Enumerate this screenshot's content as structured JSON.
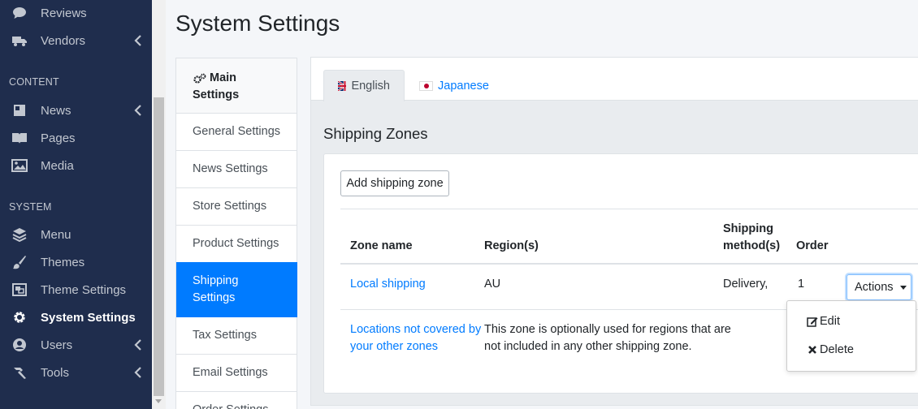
{
  "sidebar": {
    "items_top": [
      {
        "label": "Reviews",
        "icon": "comment-icon"
      },
      {
        "label": "Vendors",
        "icon": "truck-icon"
      }
    ],
    "header_content": "CONTENT",
    "content_items": [
      {
        "label": "News",
        "icon": "newspaper-icon"
      },
      {
        "label": "Pages",
        "icon": "book-icon"
      },
      {
        "label": "Media",
        "icon": "image-icon"
      }
    ],
    "header_system": "SYSTEM",
    "system_items": [
      {
        "label": "Menu",
        "icon": "layers-icon"
      },
      {
        "label": "Themes",
        "icon": "brush-icon"
      },
      {
        "label": "Theme Settings",
        "icon": "object-group-icon"
      },
      {
        "label": "System Settings",
        "icon": "gear-icon"
      },
      {
        "label": "Users",
        "icon": "users-icon"
      },
      {
        "label": "Tools",
        "icon": "hammer-icon"
      }
    ]
  },
  "page": {
    "title": "System Settings"
  },
  "settings_menu": {
    "heading_line1": "Main",
    "heading_line2": "Settings",
    "items": [
      "General Settings",
      "News Settings",
      "Store Settings",
      "Product Settings",
      "Shipping Settings",
      "Tax Settings",
      "Email Settings",
      "Order Settings"
    ]
  },
  "tabs": {
    "english": "English",
    "japanese": "Japanese"
  },
  "shipping": {
    "title": "Shipping Zones",
    "add_button": "Add shipping zone",
    "columns": {
      "zone_name": "Zone name",
      "regions": "Region(s)",
      "shipping_methods_line1": "Shipping",
      "shipping_methods_line2": "method(s)",
      "order": "Order"
    },
    "rows": [
      {
        "zone_name": "Local shipping",
        "regions": "AU",
        "methods": "Delivery,",
        "order": "1",
        "actions": "Actions"
      },
      {
        "zone_name_line1": "Locations not covered by",
        "zone_name_line2": "your other zones",
        "regions_line1": "This zone is optionally used for regions that are",
        "regions_line2": "not included in any other shipping zone."
      }
    ],
    "dropdown": {
      "edit": "Edit",
      "delete": "Delete"
    }
  },
  "colors": {
    "sidebar_bg": "#1f2d4d",
    "accent": "#007bff"
  }
}
